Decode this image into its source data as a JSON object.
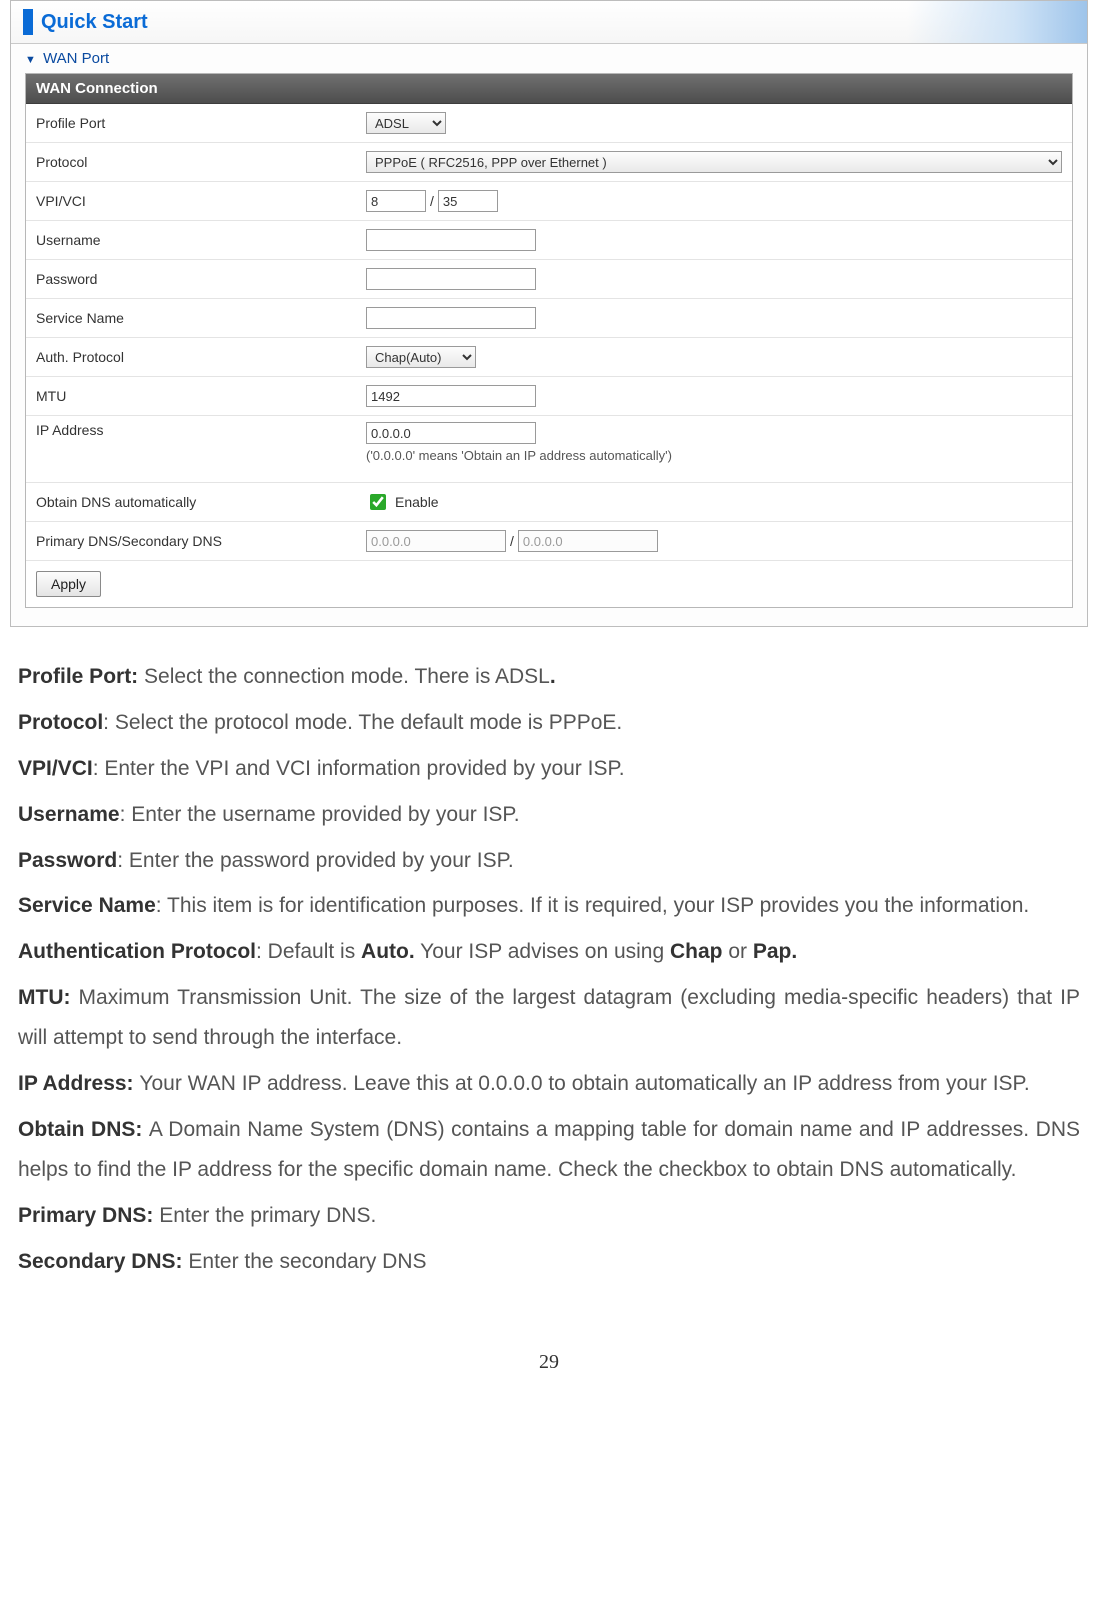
{
  "header": {
    "title": "Quick Start",
    "section": "WAN Port"
  },
  "panel": {
    "title": "WAN Connection",
    "rows": {
      "profile_port": {
        "label": "Profile Port",
        "value": "ADSL"
      },
      "protocol": {
        "label": "Protocol",
        "value": "PPPoE ( RFC2516, PPP over Ethernet )"
      },
      "vpi_vci": {
        "label": "VPI/VCI",
        "vpi": "8",
        "vci": "35"
      },
      "username": {
        "label": "Username",
        "value": ""
      },
      "password": {
        "label": "Password",
        "value": ""
      },
      "service_name": {
        "label": "Service Name",
        "value": ""
      },
      "auth_protocol": {
        "label": "Auth. Protocol",
        "value": "Chap(Auto)"
      },
      "mtu": {
        "label": "MTU",
        "value": "1492"
      },
      "ip_address": {
        "label": "IP Address",
        "value": "0.0.0.0",
        "note": "('0.0.0.0' means 'Obtain an IP address automatically')"
      },
      "obtain_dns": {
        "label": "Obtain DNS automatically",
        "checkbox_label": "Enable",
        "checked": true
      },
      "dns": {
        "label": "Primary DNS/Secondary DNS",
        "primary": "0.0.0.0",
        "secondary": "0.0.0.0"
      }
    },
    "apply_label": "Apply"
  },
  "doc": {
    "p1_bold": "Profile Port: ",
    "p1_text": "Select the connection mode.  There is ADSL",
    "p1_end": ".",
    "p2_bold": "Protocol",
    "p2_text": ": Select the protocol mode. The default mode is PPPoE.",
    "p3_bold": "VPI/VCI",
    "p3_text": ": Enter the VPI and VCI information provided by your ISP.",
    "p4_bold": "Username",
    "p4_text": ": Enter the username provided by your ISP.",
    "p5_bold": "Password",
    "p5_text": ": Enter the password provided by your ISP.",
    "p6_bold": "Service Name",
    "p6_text": ": This item is for identification purposes. If it is required, your ISP provides you the information.",
    "p7_bold": "Authentication Protocol",
    "p7_text_a": ": Default is ",
    "p7_b1": "Auto.",
    "p7_text_b": " Your ISP advises on using ",
    "p7_b2": "Chap",
    "p7_text_c": " or ",
    "p7_b3": "Pap.",
    "p8_bold": "MTU: ",
    "p8_text": "Maximum Transmission Unit. The size of the largest datagram (excluding media-specific headers) that IP will attempt to send through the interface.",
    "p9_bold": "IP Address: ",
    "p9_text": "Your WAN IP address. Leave this at 0.0.0.0 to obtain automatically an IP address from your ISP.",
    "p10_bold": "Obtain DNS: ",
    "p10_text": "A Domain Name System (DNS) contains a mapping table for domain name and IP addresses.  DNS helps to find the IP address for the specific domain name.  Check the checkbox to obtain DNS automatically.",
    "p11_bold": "Primary DNS: ",
    "p11_text": "Enter the primary DNS.",
    "p12_bold": "Secondary DNS: ",
    "p12_text": "Enter the secondary DNS"
  },
  "page_number": "29"
}
